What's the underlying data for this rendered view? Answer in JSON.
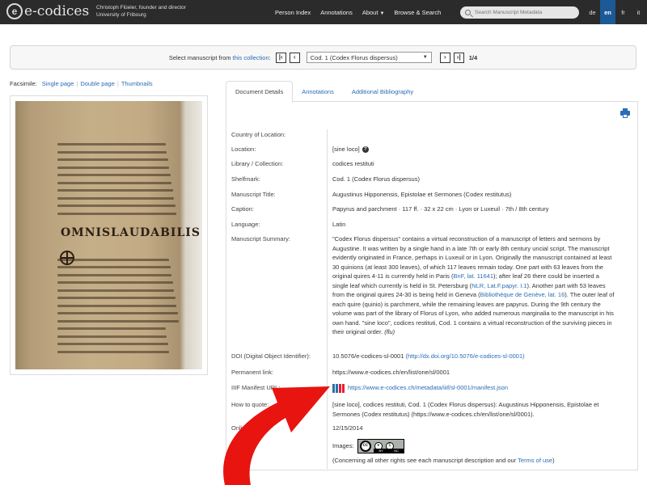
{
  "header": {
    "logo_symbol": "e",
    "logo_text": "e-codices",
    "founder_line1": "Christoph Flüeler, founder and director",
    "founder_line2": "University of Fribourg",
    "nav": [
      "Person Index",
      "Annotations",
      "About",
      "Browse & Search"
    ],
    "search_placeholder": "Search Manuscript Metadata",
    "languages": [
      "de",
      "en",
      "fr",
      "it"
    ],
    "active_language": "en"
  },
  "selector": {
    "label": "Select manuscript from",
    "link": "this collection",
    "label_end": ":",
    "first": "|‹",
    "prev": "‹",
    "selected": "Cod. 1 (Codex Florus dispersus)",
    "next": "›",
    "last": "›|",
    "count": "1/4"
  },
  "facsimile": {
    "label": "Facsimile:",
    "links": [
      "Single page",
      "Double page",
      "Thumbnails"
    ],
    "sep": "|",
    "initials": "OMNISLAUDABILIS"
  },
  "tabs": [
    "Document Details",
    "Annotations",
    "Additional Bibliography"
  ],
  "details": {
    "country_label": "Country of Location:",
    "country_value": "",
    "location_label": "Location:",
    "location_value": "[sine loco]",
    "help": "?",
    "library_label": "Library / Collection:",
    "library_value": "codices restituti",
    "shelfmark_label": "Shelfmark:",
    "shelfmark_value": "Cod. 1 (Codex Florus dispersus)",
    "title_label": "Manuscript Title:",
    "title_value": "Augustinus Hipponensis, Epistolae et Sermones (Codex restitutus)",
    "caption_label": "Caption:",
    "caption_value": "Papyrus and parchment · 117 ff. · 32 x 22 cm · Lyon or Luxeuil · 7th / 8th century",
    "language_label": "Language:",
    "language_value": "Latin",
    "summary_label": "Manuscript Summary:",
    "summary_1": "\"Codex Florus dispersus\" contains a virtual reconstruction of a manuscript of letters and sermons by Augustine. It was written by a single hand in a late 7th or early 8th century uncial script. The manuscript evidently originated in France, perhaps in Luxeuil or in Lyon. Originally the manuscript contained at least 30 quinions (at least 300 leaves), of which 117 leaves remain today. One part with 63 leaves from the original quires 4-11 is currently held in Paris (",
    "summary_link1": "BnF, lat. 11641",
    "summary_2": "); after leaf 26 there could be inserted a single leaf which currently is held in St. Petersburg (",
    "summary_link2": "NLR, Lat.F.papyr. I.1",
    "summary_3": "). Another part with 53 leaves from the original quires 24-30 is being held in Geneva (",
    "summary_link3": "Bibliothèque de Genève, lat. 16",
    "summary_4": "). The outer leaf of each quire (quinio) is parchment, while the remaining leaves are papyrus. During the 9th century the volume was part of the library of Florus of Lyon, who added numerous marginalia to the manuscript in his own hand. \"sine loco\", codices restituti, Cod. 1 contains a virtual reconstruction of the surviving pieces in their original order.",
    "summary_author": "(flu)",
    "doi_label": "DOI (Digital Object Identifier):",
    "doi_value": "10.5076/e-codices-sl-0001",
    "doi_link": "(http://dx.doi.org/10.5076/e-codices-sl-0001)",
    "permalink_label": "Permanent link:",
    "permalink_value": "https://www.e-codices.ch/en/list/one/sl/0001",
    "iiif_label": "IIIF Manifest URL:",
    "iiif_value": "https://www.e-codices.ch/metadata/iiif/sl-0001/manifest.json",
    "quote_label": "How to quote:",
    "quote_value": "[sine loco], codices restituti, Cod. 1 (Codex Florus dispersus): Augustinus Hipponensis, Epistolae et Sermones (Codex restitutus) (https://www.e-codices.ch/en/list/one/sl/0001).",
    "online_label": "Online Since:",
    "online_value": "12/15/2014",
    "rights_label": "Rights:",
    "rights_images": "Images:",
    "cc_symbol": "cc",
    "cc_by": "BY",
    "cc_nc": "NC",
    "rights_note_1": "(Concerning all other rights see each manuscript description and our ",
    "rights_link": "Terms of use",
    "rights_note_2": ")"
  },
  "colors": {
    "nav_bg": "#2b2b2b",
    "accent": "#1b5a96",
    "link": "#2a6db5",
    "arrow": "#e8140f"
  }
}
